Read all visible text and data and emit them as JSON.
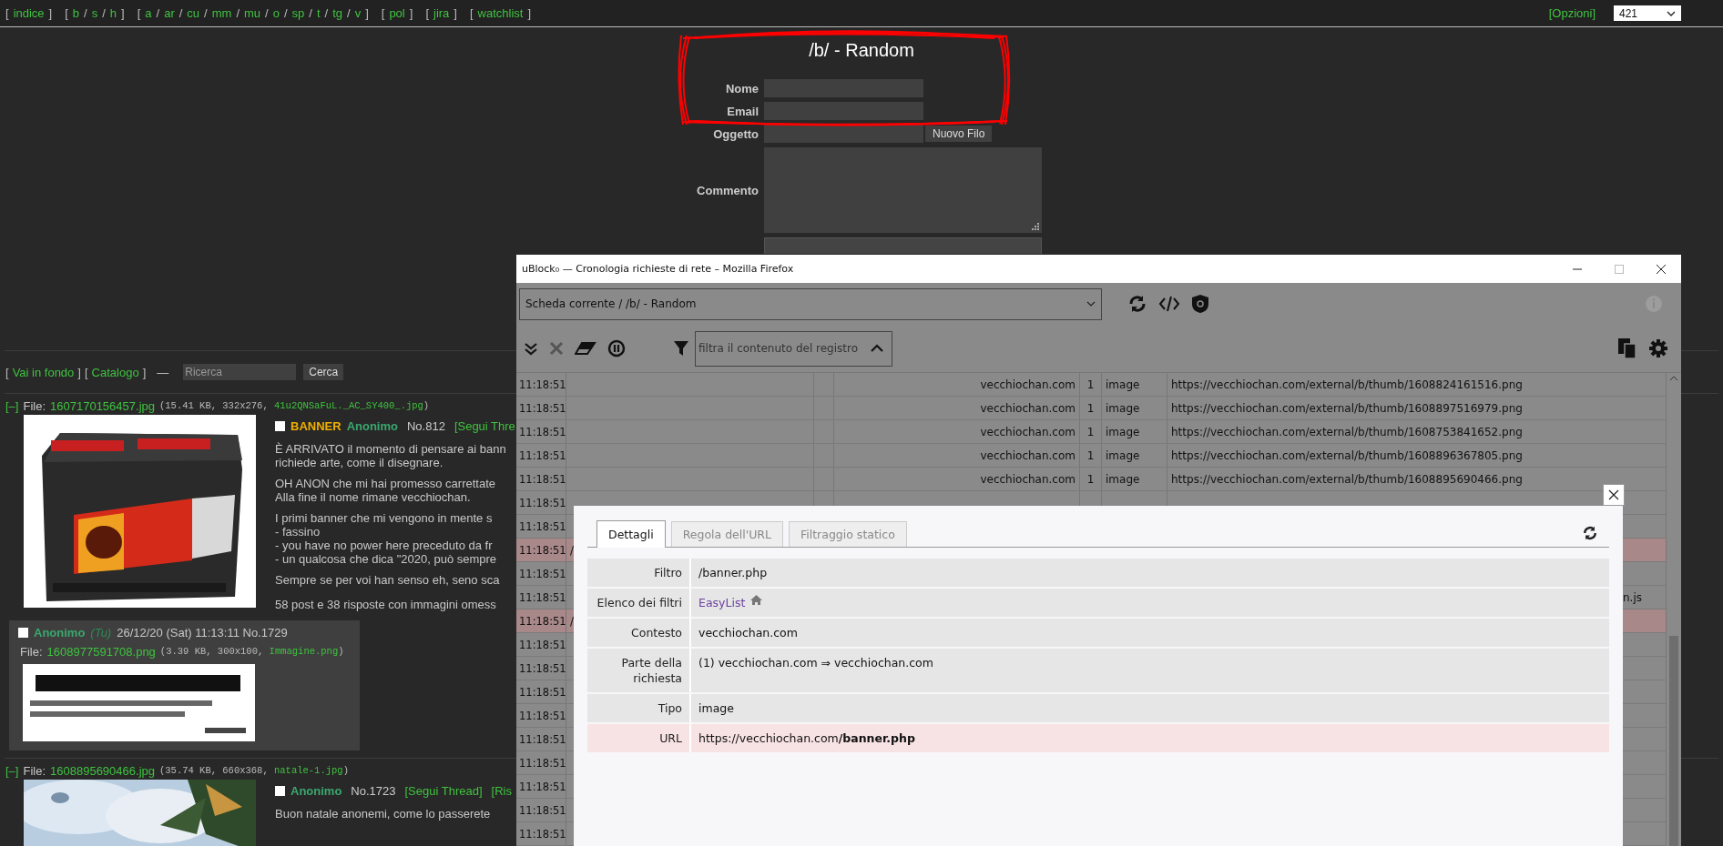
{
  "nav": {
    "open": "[",
    "close": "]",
    "separator": "/",
    "groups": [
      {
        "items": [
          "indice"
        ]
      },
      {
        "items": [
          "b",
          "s",
          "h"
        ]
      },
      {
        "items": [
          "a",
          "ar",
          "cu",
          "mm",
          "mu",
          "o",
          "sp",
          "t",
          "tg",
          "v"
        ]
      },
      {
        "items": [
          "pol"
        ]
      },
      {
        "items": [
          "jira"
        ]
      },
      {
        "items": [
          "watchlist"
        ]
      }
    ],
    "options": "[Opzioni]",
    "board_select": "421"
  },
  "board_title": "/b/ - Random",
  "form": {
    "fields": [
      {
        "label": "Nome",
        "kind": "input"
      },
      {
        "label": "Email",
        "kind": "input"
      },
      {
        "label": "Oggetto",
        "kind": "input",
        "button": "Nuovo Filo"
      },
      {
        "label": "Commento",
        "kind": "textarea"
      }
    ]
  },
  "thread_nav": {
    "links": [
      "Vai in fondo",
      "Catalogo"
    ],
    "dash": "—",
    "search_placeholder": "Ricerca",
    "search_button": "Cerca"
  },
  "posts": [
    {
      "kind": "thread",
      "toggle": "[–]",
      "file_label": "File:",
      "file_name": "1607170156457.jpg",
      "file_info": "(15.41 KB, 332x276, ",
      "original_name": "41u2QNSaFuL._AC_SY400_.jpg",
      "file_info_end": ")",
      "checked": false,
      "tag": "BANNER",
      "name": "Anonimo",
      "number": "No.812",
      "links": [
        "[Segui Thre"
      ],
      "paragraphs": [
        [
          "È ARRIVATO il momento di pensare ai bann",
          "richiede arte, come il disegnare."
        ],
        [
          "OH ANON che mi hai promesso carrettate",
          "Alla fine il nome rimane vecchiochan."
        ],
        [
          "I primi banner che mi vengono in mente s",
          "- fassino",
          "- you have no power here preceduto da fr",
          "- un qualcosa che dica \"2020, può sempre"
        ],
        [
          "Sempre se per voi han senso eh, seno sca"
        ]
      ],
      "omitted": "58 post e 38 risposte con immagini omess"
    },
    {
      "kind": "reply",
      "checked": false,
      "name": "Anonimo",
      "you": "(Tu)",
      "date": "26/12/20 (Sat) 11:13:11 No.1729",
      "file_label": "File:",
      "file_name": "1608977591708.png",
      "file_info": "(3.39 KB, 300x100, ",
      "original_name": "Immagine.png",
      "file_info_end": ")"
    },
    {
      "kind": "thread",
      "toggle": "[–]",
      "file_label": "File:",
      "file_name": "1608895690466.jpg",
      "file_info": "(35.74 KB, 660x368, ",
      "original_name": "natale-1.jpg",
      "file_info_end": ")",
      "checked": false,
      "name": "Anonimo",
      "number": "No.1723",
      "links": [
        "[Segui Thread]",
        "[Ris"
      ],
      "paragraphs": [
        [
          "Buon natale anonemi, come lo passerete"
        ]
      ]
    }
  ],
  "window": {
    "title": "uBlock₀ — Cronologia richieste di rete – Mozilla Firefox",
    "scope": "Scheda corrente / /b/ - Random",
    "filter_placeholder": "filtra il contenuto del registro",
    "rows": [
      {
        "time": "11:18:51",
        "domain": "vecchiochan.com",
        "count": "1",
        "type": "image",
        "url": "https://vecchiochan.com/external/b/thumb/1608824161516.png",
        "blocked": false
      },
      {
        "time": "11:18:51",
        "domain": "vecchiochan.com",
        "count": "1",
        "type": "image",
        "url": "https://vecchiochan.com/external/b/thumb/1608897516979.png",
        "blocked": false
      },
      {
        "time": "11:18:51",
        "domain": "vecchiochan.com",
        "count": "1",
        "type": "image",
        "url": "https://vecchiochan.com/external/b/thumb/1608753841652.png",
        "blocked": false
      },
      {
        "time": "11:18:51",
        "domain": "vecchiochan.com",
        "count": "1",
        "type": "image",
        "url": "https://vecchiochan.com/external/b/thumb/1608896367805.png",
        "blocked": false
      },
      {
        "time": "11:18:51",
        "domain": "vecchiochan.com",
        "count": "1",
        "type": "image",
        "url": "https://vecchiochan.com/external/b/thumb/1608895690466.png",
        "blocked": false
      },
      {
        "time": "11:18:51",
        "blocked": false
      },
      {
        "time": "11:18:51",
        "blocked": false
      },
      {
        "time": "11:18:51",
        "filter": "/",
        "blocked": true
      },
      {
        "time": "11:18:51",
        "blocked": false
      },
      {
        "time": "11:18:51",
        "url_end": "n.js",
        "blocked": false
      },
      {
        "time": "11:18:51",
        "filter": "/",
        "blocked": true
      },
      {
        "time": "11:18:51",
        "blocked": false
      },
      {
        "time": "11:18:51",
        "blocked": false
      },
      {
        "time": "11:18:51",
        "blocked": false
      },
      {
        "time": "11:18:51",
        "blocked": false
      },
      {
        "time": "11:18:51",
        "blocked": false
      },
      {
        "time": "11:18:51",
        "blocked": false
      },
      {
        "time": "11:18:51",
        "blocked": false
      },
      {
        "time": "11:18:51",
        "blocked": false
      },
      {
        "time": "11:18:51",
        "blocked": false
      }
    ],
    "details": {
      "tabs": [
        {
          "label": "Dettagli",
          "selected": true
        },
        {
          "label": "Regola dell'URL",
          "selected": false
        },
        {
          "label": "Filtraggio statico",
          "selected": false
        }
      ],
      "rows": [
        {
          "label": "Filtro",
          "value": "/banner.php",
          "kind": "text"
        },
        {
          "label": "Elenco dei filtri",
          "value": "EasyList",
          "kind": "link"
        },
        {
          "label": "Contesto",
          "value": "vecchiochan.com",
          "kind": "text"
        },
        {
          "label": "Parte della richiesta",
          "value": "(1)  vecchiochan.com ⇒ vecchiochan.com",
          "kind": "text"
        },
        {
          "label": "Tipo",
          "value": "image",
          "kind": "text"
        },
        {
          "label": "URL",
          "value": "https://vecchiochan.com**/banner.php**",
          "kind": "url"
        }
      ]
    }
  }
}
